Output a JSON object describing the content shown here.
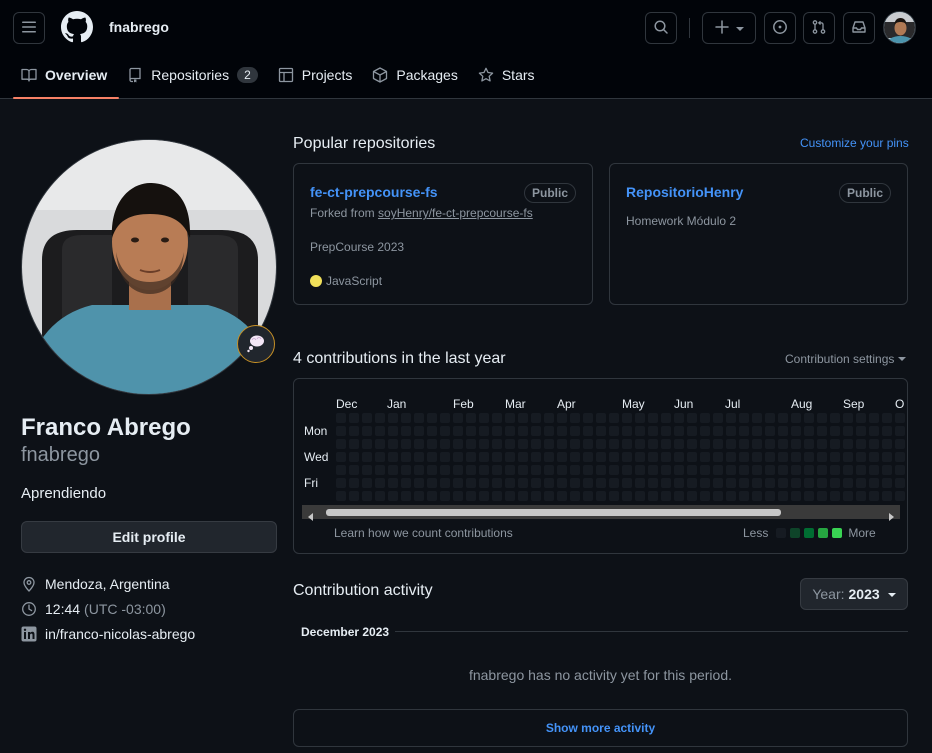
{
  "header": {
    "username": "fnabrego"
  },
  "tabs": [
    {
      "label": "Overview",
      "icon": "book-icon"
    },
    {
      "label": "Repositories",
      "icon": "repo-icon",
      "count": "2"
    },
    {
      "label": "Projects",
      "icon": "table-icon"
    },
    {
      "label": "Packages",
      "icon": "package-icon"
    },
    {
      "label": "Stars",
      "icon": "star-icon"
    }
  ],
  "profile": {
    "full_name": "Franco Abrego",
    "login": "fnabrego",
    "bio": "Aprendiendo",
    "edit_label": "Edit profile",
    "location": "Mendoza, Argentina",
    "time": "12:44",
    "timezone": "(UTC -03:00)",
    "linkedin": "in/franco-nicolas-abrego"
  },
  "popular": {
    "title": "Popular repositories",
    "customize_label": "Customize your pins",
    "repos": [
      {
        "name": "fe-ct-prepcourse-fs",
        "visibility": "Public",
        "forked_prefix": "Forked from ",
        "forked_from": "soyHenry/fe-ct-prepcourse-fs",
        "description": "PrepCourse 2023",
        "language": "JavaScript",
        "language_color": "#f1e05a"
      },
      {
        "name": "RepositorioHenry",
        "visibility": "Public",
        "description": "Homework Módulo 2"
      }
    ]
  },
  "contributions": {
    "title": "4 contributions in the last year",
    "settings_label": "Contribution settings",
    "months": [
      "Dec",
      "Jan",
      "Feb",
      "Mar",
      "Apr",
      "May",
      "Jun",
      "Jul",
      "Aug",
      "Sep",
      "O"
    ],
    "days": [
      "Mon",
      "Wed",
      "Fri"
    ],
    "learn_label": "Learn how we count contributions",
    "less_label": "Less",
    "more_label": "More",
    "level_colors": [
      "#161b22",
      "#0e4429",
      "#006d32",
      "#26a641",
      "#39d353"
    ]
  },
  "activity": {
    "title": "Contribution activity",
    "year_prefix": "Year:",
    "year_value": "2023",
    "month_label": "December 2023",
    "empty_message": "fnabrego has no activity yet for this period.",
    "show_more_label": "Show more activity"
  }
}
